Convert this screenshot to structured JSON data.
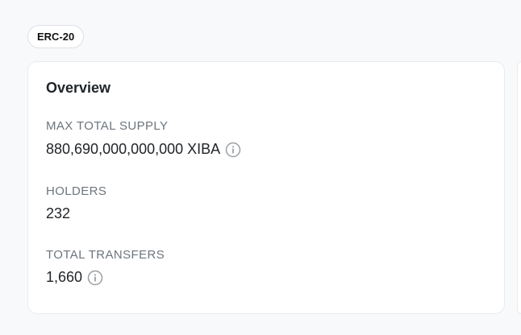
{
  "token": {
    "standard_badge": "ERC-20"
  },
  "overview": {
    "title": "Overview",
    "max_total_supply": {
      "label": "MAX TOTAL SUPPLY",
      "value": "880,690,000,000,000 XIBA",
      "icon": "info-icon"
    },
    "holders": {
      "label": "HOLDERS",
      "value": "232"
    },
    "total_transfers": {
      "label": "TOTAL TRANSFERS",
      "value": "1,660",
      "icon": "info-icon"
    }
  },
  "colors": {
    "background": "#f8f9fa",
    "card": "#ffffff",
    "border": "#e9ecef",
    "label": "#6c757d",
    "text": "#212529"
  }
}
